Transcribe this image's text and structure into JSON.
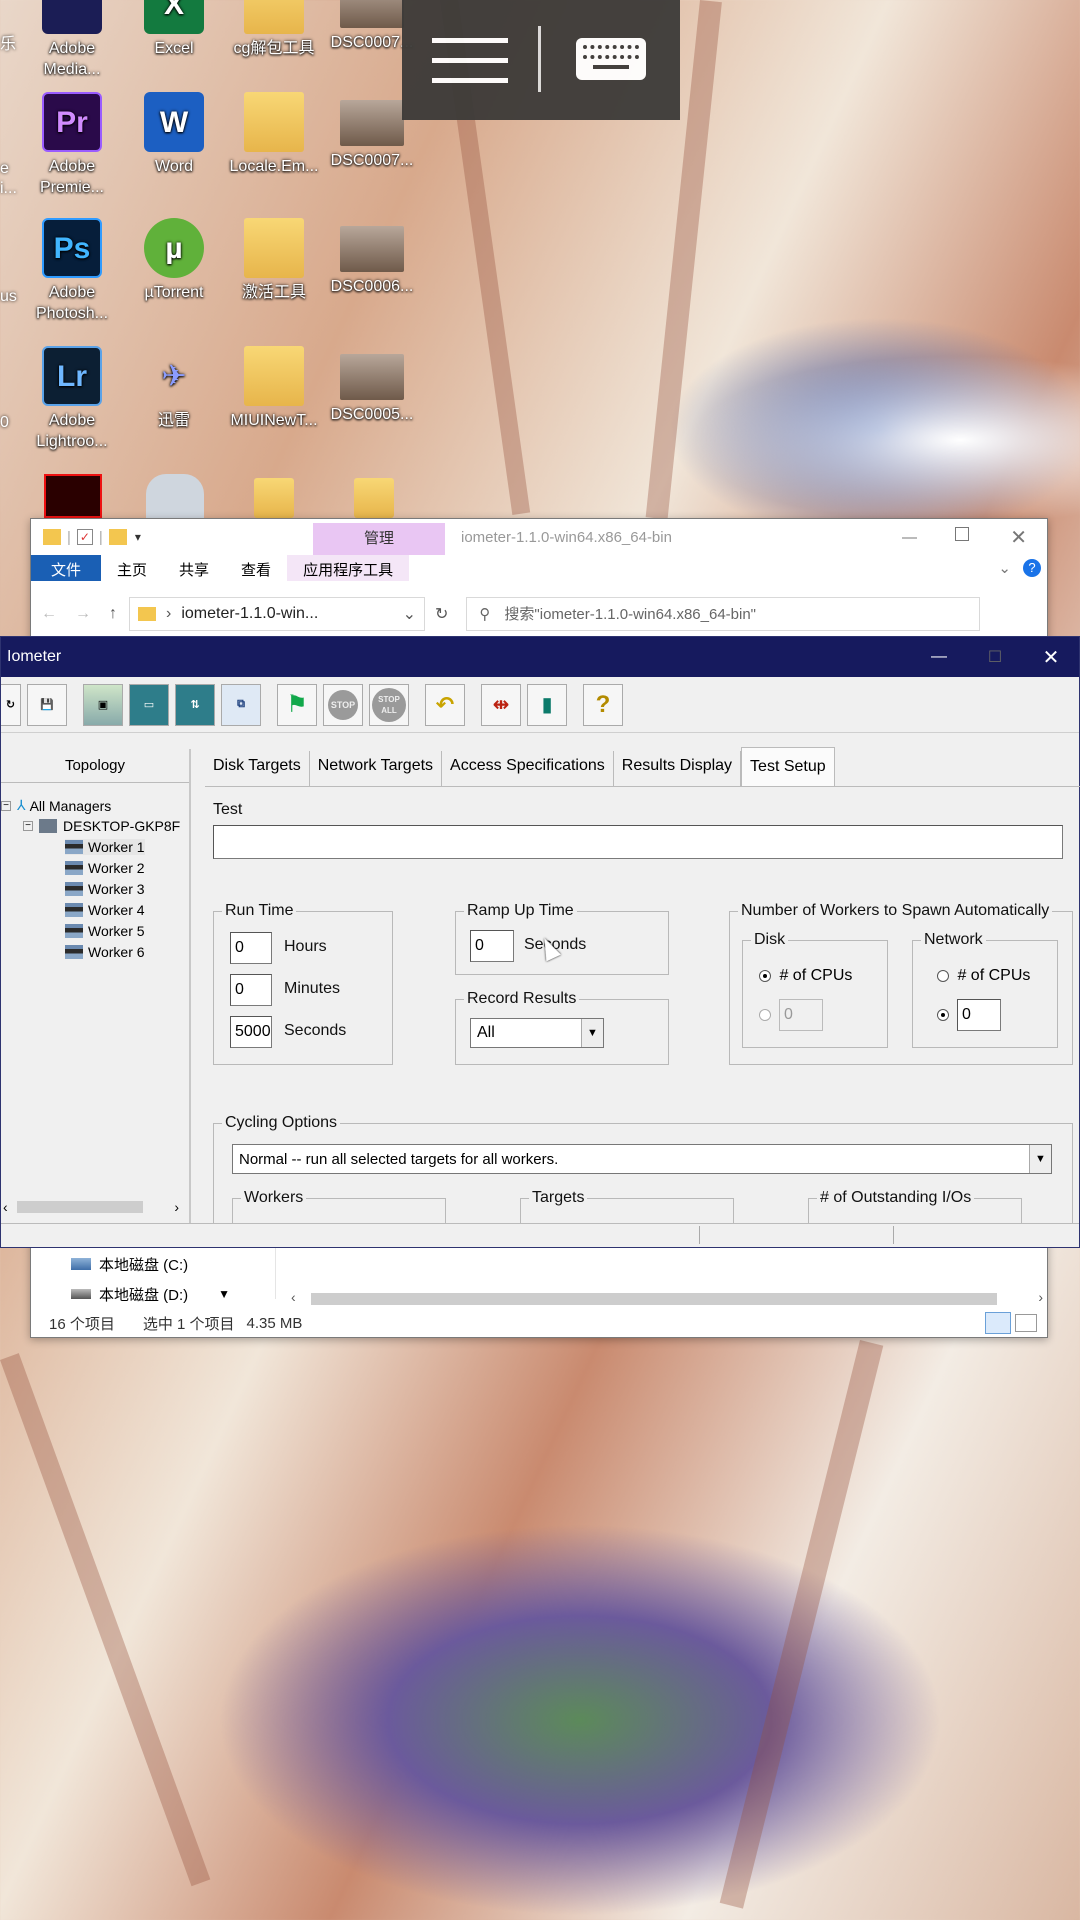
{
  "desktop": {
    "icons": [
      {
        "label": "Adobe Media...",
        "glyph": ""
      },
      {
        "label": "Excel",
        "glyph": "X"
      },
      {
        "label": "cg解包工具",
        "glyph": ""
      },
      {
        "label": "DSC0007...",
        "glyph": ""
      },
      {
        "label": "Adobe Premie...",
        "glyph": "Pr"
      },
      {
        "label": "Word",
        "glyph": "W"
      },
      {
        "label": "Locale.Em...",
        "glyph": ""
      },
      {
        "label": "DSC0007...",
        "glyph": ""
      },
      {
        "label": "Adobe Photosh...",
        "glyph": "Ps"
      },
      {
        "label": "µTorrent",
        "glyph": "µ"
      },
      {
        "label": "激活工具",
        "glyph": ""
      },
      {
        "label": "DSC0006...",
        "glyph": ""
      },
      {
        "label": "Adobe Lightroo...",
        "glyph": "Lr"
      },
      {
        "label": "迅雷",
        "glyph": "✈"
      },
      {
        "label": "MIUINewT...",
        "glyph": ""
      },
      {
        "label": "DSC0005...",
        "glyph": ""
      }
    ],
    "edge_labels": [
      "乐",
      "e",
      "i...",
      "us",
      "...",
      "0"
    ]
  },
  "explorer": {
    "title": "iometer-1.1.0-win64.x86_64-bin",
    "manage_tab": "管理",
    "ribbon_tabs": [
      "文件",
      "主页",
      "共享",
      "查看",
      "应用程序工具"
    ],
    "address": "iometer-1.1.0-win...",
    "search_placeholder": "搜索\"iometer-1.1.0-win64.x86_64-bin\"",
    "drives": [
      "本地磁盘 (C:)",
      "本地磁盘 (D:)"
    ],
    "status": {
      "count": "16 个项目",
      "selected": "选中 1 个项目",
      "size": "4.35 MB"
    }
  },
  "iometer": {
    "title": "Iometer",
    "toolbar_labels": {
      "stop": "STOP",
      "stop_all": "STOP ALL",
      "help": "?"
    },
    "topology": {
      "header": "Topology",
      "root": "All Managers",
      "manager": "DESKTOP-GKP8F",
      "workers": [
        "Worker 1",
        "Worker 2",
        "Worker 3",
        "Worker 4",
        "Worker 5",
        "Worker 6"
      ]
    },
    "tabs": [
      "Disk Targets",
      "Network Targets",
      "Access Specifications",
      "Results Display",
      "Test Setup"
    ],
    "active_tab": "Test Setup",
    "test_setup": {
      "test_label": "Test",
      "test_value": "",
      "run_time": {
        "label": "Run Time",
        "hours": "0",
        "hours_label": "Hours",
        "minutes": "0",
        "minutes_label": "Minutes",
        "seconds": "5000",
        "seconds_label": "Seconds"
      },
      "ramp_up": {
        "label": "Ramp Up Time",
        "value": "0",
        "unit": "Seconds"
      },
      "record_results": {
        "label": "Record Results",
        "value": "All"
      },
      "spawn": {
        "label": "Number of Workers to Spawn Automatically",
        "disk": {
          "label": "Disk",
          "cpus_label": "# of CPUs",
          "value": "0"
        },
        "network": {
          "label": "Network",
          "cpus_label": "# of CPUs",
          "value": "0"
        }
      },
      "cycling": {
        "label": "Cycling Options",
        "value": "Normal -- run all selected targets for all workers.",
        "sub_groups": [
          "Workers",
          "Targets",
          "# of Outstanding I/Os"
        ]
      }
    }
  },
  "colors": {
    "iometer_title": "#161a5e",
    "explorer_manage_tab": "#e9c6f3",
    "explorer_file_tab": "#1a5fb4"
  }
}
